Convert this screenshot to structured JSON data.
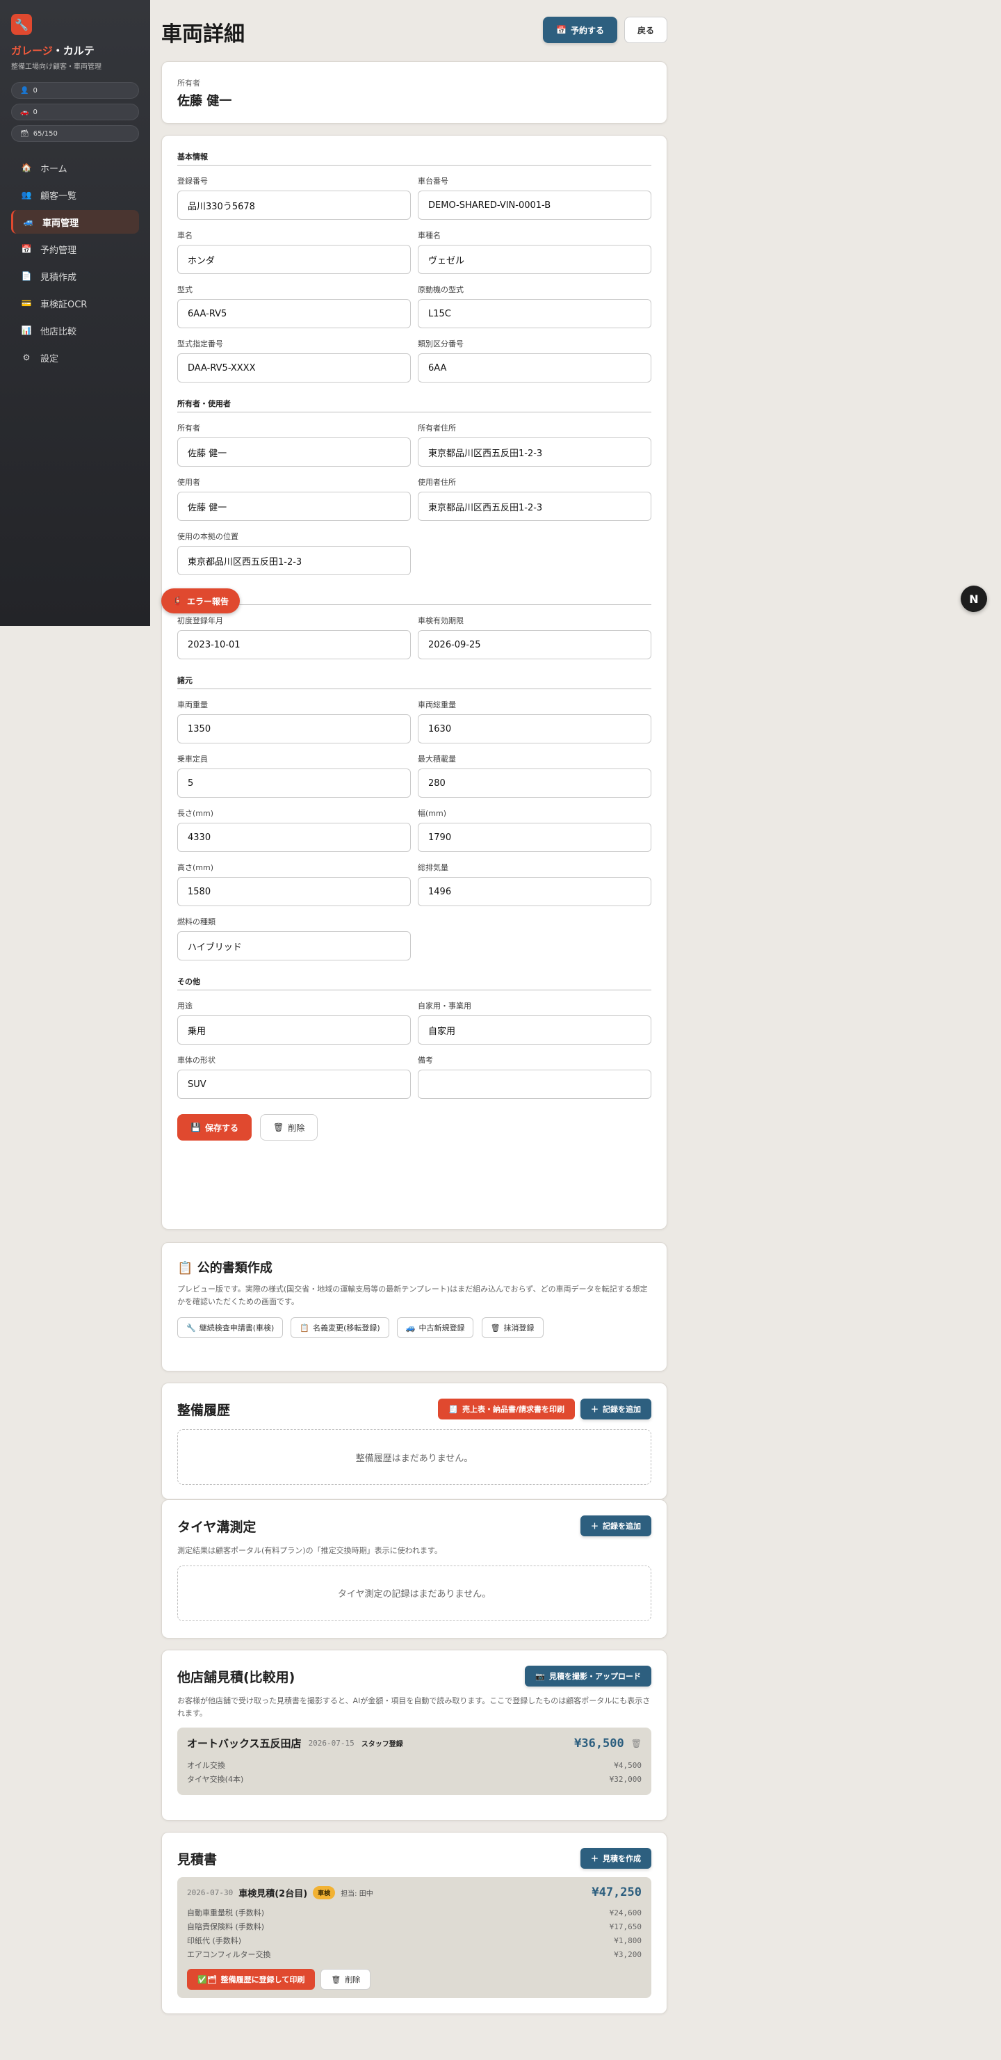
{
  "sidebar": {
    "logo_icon": "🔧",
    "brand_prefix": "ガレージ",
    "brand_dot": "・",
    "brand_suffix": "カルテ",
    "subtitle": "整備工場向け顧客・車両管理",
    "pills": [
      {
        "icon": "👤",
        "value": "0"
      },
      {
        "icon": "🚗",
        "value": "0"
      },
      {
        "icon": "🗃",
        "value": "65/150"
      }
    ],
    "nav": [
      {
        "icon": "🏠",
        "label": "ホーム"
      },
      {
        "icon": "👥",
        "label": "顧客一覧"
      },
      {
        "icon": "🚙",
        "label": "車両管理"
      },
      {
        "icon": "📅",
        "label": "予約管理"
      },
      {
        "icon": "📄",
        "label": "見積作成"
      },
      {
        "icon": "💳",
        "label": "車検証OCR"
      },
      {
        "icon": "📊",
        "label": "他店比較"
      },
      {
        "icon": "⚙",
        "label": "設定"
      }
    ]
  },
  "header": {
    "title": "車両詳細",
    "reserve_icon": "📅",
    "reserve_label": "予約する",
    "back_label": "戻る"
  },
  "owner_card": {
    "label": "所有者",
    "name": "佐藤 健一"
  },
  "form": {
    "basic": {
      "title": "基本情報",
      "fields": [
        {
          "label": "登録番号",
          "value": "品川330う5678"
        },
        {
          "label": "車台番号",
          "value": "DEMO-SHARED-VIN-0001-B"
        },
        {
          "label": "車名",
          "value": "ホンダ"
        },
        {
          "label": "車種名",
          "value": "ヴェゼル"
        },
        {
          "label": "型式",
          "value": "6AA-RV5"
        },
        {
          "label": "原動機の型式",
          "value": "L15C"
        },
        {
          "label": "型式指定番号",
          "value": "DAA-RV5-XXXX"
        },
        {
          "label": "類別区分番号",
          "value": "6AA"
        }
      ]
    },
    "owner": {
      "title": "所有者・使用者",
      "fields": [
        {
          "label": "所有者",
          "value": "佐藤 健一"
        },
        {
          "label": "所有者住所",
          "value": "東京都品川区西五反田1-2-3"
        },
        {
          "label": "使用者",
          "value": "佐藤 健一"
        },
        {
          "label": "使用者住所",
          "value": "東京都品川区西五反田1-2-3"
        },
        {
          "label": "使用の本拠の位置",
          "value": "東京都品川区西五反田1-2-3"
        }
      ]
    },
    "registration": {
      "title": "登録・有効期限",
      "fields": [
        {
          "label": "初度登録年月",
          "value": "2023-10-01"
        },
        {
          "label": "車検有効期限",
          "value": "2026-09-25"
        }
      ]
    },
    "specs": {
      "title": "諸元",
      "fields": [
        {
          "label": "車両重量",
          "value": "1350"
        },
        {
          "label": "車両総重量",
          "value": "1630"
        },
        {
          "label": "乗車定員",
          "value": "5"
        },
        {
          "label": "最大積載量",
          "value": "280"
        },
        {
          "label": "長さ(mm)",
          "value": "4330"
        },
        {
          "label": "幅(mm)",
          "value": "1790"
        },
        {
          "label": "高さ(mm)",
          "value": "1580"
        },
        {
          "label": "総排気量",
          "value": "1496"
        },
        {
          "label": "燃料の種類",
          "value": "ハイブリッド"
        }
      ]
    },
    "other": {
      "title": "その他",
      "fields": [
        {
          "label": "用途",
          "value": "乗用"
        },
        {
          "label": "自家用・事業用",
          "value": "自家用"
        },
        {
          "label": "車体の形状",
          "value": "SUV"
        },
        {
          "label": "備考",
          "value": ""
        }
      ]
    },
    "save_icon": "💾",
    "save_label": "保存する",
    "delete_icon": "🗑",
    "delete_label": "削除"
  },
  "documents": {
    "icon": "📋",
    "title": "公的書類作成",
    "description": "プレビュー版です。実際の様式(国交省・地域の運輸支局等の最新テンプレート)はまだ組み込んでおらず、どの車両データを転記する想定かを確認いただくための画面です。",
    "buttons": [
      {
        "icon": "🔧",
        "label": "継続検査申請書(車検)"
      },
      {
        "icon": "📋",
        "label": "名義変更(移転登録)"
      },
      {
        "icon": "🚙",
        "label": "中古新規登録"
      },
      {
        "icon": "🗑",
        "label": "抹消登録"
      }
    ]
  },
  "maintenance": {
    "title": "整備履歴",
    "print_icon": "🧾",
    "print_label": "売上表・納品書/請求書を印刷",
    "add_icon": "＋",
    "add_label": "記録を追加",
    "empty": "整備履歴はまだありません。"
  },
  "tire": {
    "title": "タイヤ溝測定",
    "add_icon": "＋",
    "add_label": "記録を追加",
    "description": "測定結果は顧客ポータル(有料プラン)の「推定交換時期」表示に使われます。",
    "empty": "タイヤ測定の記録はまだありません。"
  },
  "competitor": {
    "title": "他店舗見積(比較用)",
    "upload_icon": "📷",
    "upload_label": "見積を撮影・アップロード",
    "description": "お客様が他店舗で受け取った見積書を撮影すると、AIが金額・項目を自動で読み取ります。ここで登録したものは顧客ポータルにも表示されます。",
    "entry": {
      "shop": "オートバックス五反田店",
      "date": "2026-07-15",
      "tag": "スタッフ登録",
      "total": "¥36,500",
      "delete_icon": "🗑",
      "lines": [
        {
          "name": "オイル交換",
          "price": "¥4,500"
        },
        {
          "name": "タイヤ交換(4本)",
          "price": "¥32,000"
        }
      ]
    }
  },
  "estimate": {
    "title": "見積書",
    "create_icon": "＋",
    "create_label": "見積を作成",
    "entry": {
      "date": "2026-07-30",
      "name": "車検見積(2台目)",
      "badge": "車検",
      "staff": "担当: 田中",
      "total": "¥47,250",
      "lines": [
        {
          "name": "自動車重量税 (手数料)",
          "price": "¥24,600"
        },
        {
          "name": "自賠責保険料 (手数料)",
          "price": "¥17,650"
        },
        {
          "name": "印紙代 (手数料)",
          "price": "¥1,800"
        },
        {
          "name": "エアコンフィルター交換",
          "price": "¥3,200"
        }
      ],
      "register_icon": "✅🗂",
      "register_label": "整備履歴に登録して印刷",
      "delete_icon": "🗑",
      "delete_label": "削除"
    }
  },
  "floating": {
    "error_icon": "🧯",
    "error_label": "エラー報告",
    "n_badge": "N"
  },
  "colors": {
    "accent_red": "#e0492f",
    "accent_blue": "#2d5f7f",
    "background": "#ece9e4"
  }
}
